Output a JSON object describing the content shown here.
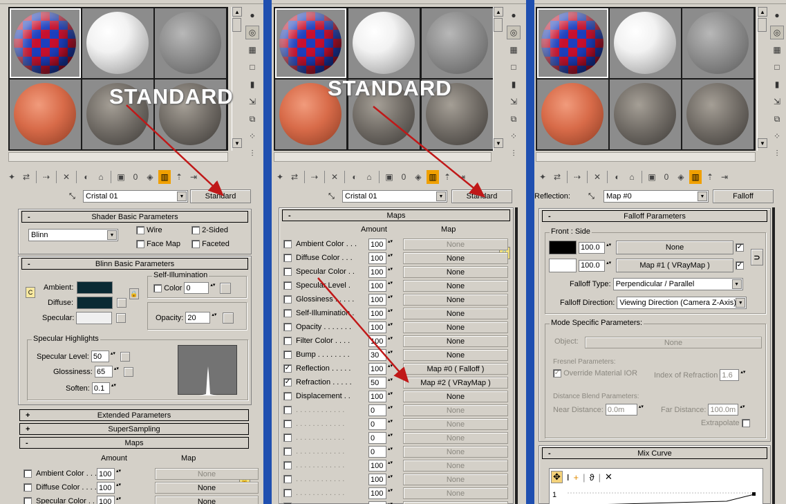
{
  "overlay_label": "STANDARD",
  "panel1": {
    "material_name": "Cristal 01",
    "type_button": "Standard",
    "shader": {
      "title": "Shader Basic Parameters",
      "shader_value": "Blinn",
      "wire": "Wire",
      "two_sided": "2-Sided",
      "face_map": "Face Map",
      "faceted": "Faceted"
    },
    "blinn": {
      "title": "Blinn Basic Parameters",
      "self_illum": "Self-Illumination",
      "color": "Color",
      "color_value": "0",
      "ambient": "Ambient:",
      "diffuse": "Diffuse:",
      "specular": "Specular:",
      "opacity": "Opacity:",
      "opacity_value": "20",
      "ambient_letter": "C"
    },
    "spec": {
      "title": "Specular Highlights",
      "level": "Specular Level:",
      "level_value": "50",
      "gloss": "Glossiness:",
      "gloss_value": "65",
      "soften": "Soften:",
      "soften_value": "0.1"
    },
    "extended": "Extended Parameters",
    "supersampling": "SuperSampling",
    "maps_title": "Maps",
    "amount_hdr": "Amount",
    "map_hdr": "Map",
    "maps": [
      {
        "label": "Ambient Color . . .",
        "amount": "100",
        "map": "None",
        "dim": true
      },
      {
        "label": "Diffuse Color . . . .",
        "amount": "100",
        "map": "None",
        "dim": false
      },
      {
        "label": "Specular Color . .",
        "amount": "100",
        "map": "None",
        "dim": false
      }
    ]
  },
  "panel2": {
    "material_name": "Cristal 01",
    "type_button": "Standard",
    "maps_title": "Maps",
    "amount_hdr": "Amount",
    "map_hdr": "Map",
    "maps": [
      {
        "label": "Ambient Color . . .",
        "amount": "100",
        "map": "None",
        "checked": false,
        "dim": true
      },
      {
        "label": "Diffuse Color . . .",
        "amount": "100",
        "map": "None",
        "checked": false,
        "dim": false
      },
      {
        "label": "Specular Color . .",
        "amount": "100",
        "map": "None",
        "checked": false,
        "dim": false
      },
      {
        "label": "Specular Level .",
        "amount": "100",
        "map": "None",
        "checked": false,
        "dim": false
      },
      {
        "label": "Glossiness . . . . .",
        "amount": "100",
        "map": "None",
        "checked": false,
        "dim": false
      },
      {
        "label": "Self-Illumination .",
        "amount": "100",
        "map": "None",
        "checked": false,
        "dim": false
      },
      {
        "label": "Opacity . . . . . . .",
        "amount": "100",
        "map": "None",
        "checked": false,
        "dim": false
      },
      {
        "label": "Filter Color . . . .",
        "amount": "100",
        "map": "None",
        "checked": false,
        "dim": false
      },
      {
        "label": "Bump . . . . . . . .",
        "amount": "30",
        "map": "None",
        "checked": false,
        "dim": false
      },
      {
        "label": "Reflection . . . . .",
        "amount": "100",
        "map": "Map #0  ( Falloff )",
        "checked": true,
        "dim": false
      },
      {
        "label": "Refraction . . . . .",
        "amount": "50",
        "map": "Map #2  ( VRayMap )",
        "checked": true,
        "dim": false
      },
      {
        "label": "Displacement . .",
        "amount": "100",
        "map": "None",
        "checked": false,
        "dim": false
      },
      {
        "label": ". . . . . . . . . . . .",
        "amount": "0",
        "map": "None",
        "checked": false,
        "dim": true
      },
      {
        "label": ". . . . . . . . . . . .",
        "amount": "0",
        "map": "None",
        "checked": false,
        "dim": true
      },
      {
        "label": ". . . . . . . . . . . .",
        "amount": "0",
        "map": "None",
        "checked": false,
        "dim": true
      },
      {
        "label": ". . . . . . . . . . . .",
        "amount": "0",
        "map": "None",
        "checked": false,
        "dim": true
      },
      {
        "label": ". . . . . . . . . . . .",
        "amount": "100",
        "map": "None",
        "checked": false,
        "dim": true
      },
      {
        "label": ". . . . . . . . . . . .",
        "amount": "100",
        "map": "None",
        "checked": false,
        "dim": true
      },
      {
        "label": ". . . . . . . . . . . .",
        "amount": "100",
        "map": "None",
        "checked": false,
        "dim": true
      },
      {
        "label": ". . . . . . . . . . . .",
        "amount": "100",
        "map": "None",
        "checked": false,
        "dim": true
      }
    ]
  },
  "panel3": {
    "slot_label": "Reflection:",
    "material_name": "Map #0",
    "type_button": "Falloff",
    "falloff_title": "Falloff Parameters",
    "front_side": "Front : Side",
    "row1_value": "100.0",
    "row1_map": "None",
    "row2_value": "100.0",
    "row2_map": "Map #1  ( VRayMap )",
    "falloff_type_label": "Falloff Type:",
    "falloff_type": "Perpendicular / Parallel",
    "falloff_dir_label": "Falloff Direction:",
    "falloff_dir": "Viewing Direction (Camera Z-Axis)",
    "mode_title": "Mode Specific Parameters:",
    "object_label": "Object:",
    "object_value": "None",
    "fresnel_title": "Fresnel Parameters:",
    "override": "Override Material IOR",
    "ior_label": "Index of Refraction",
    "ior_value": "1.6",
    "dist_title": "Distance Blend Parameters:",
    "near_label": "Near Distance:",
    "near_value": "0.0m",
    "far_label": "Far Distance:",
    "far_value": "100.0m",
    "extrapolate": "Extrapolate",
    "mix_title": "Mix Curve",
    "curve_num": "1"
  },
  "colors": {
    "panel": "#d4d0c8",
    "arrow": "#c01818",
    "divider": "#1f4fb0"
  }
}
